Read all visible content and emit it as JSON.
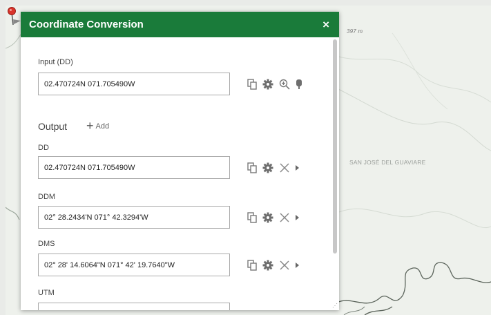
{
  "map": {
    "scale_text": "397 m",
    "place_name": "SAN JOSÉ DEL GUAVIARE"
  },
  "panel": {
    "title": "Coordinate Conversion",
    "close_glyph": "×"
  },
  "input": {
    "label": "Input (DD)",
    "value": "02.470724N 071.705490W",
    "icons": [
      "copy-icon",
      "gear-icon",
      "zoom-in-icon",
      "map-pin-icon"
    ]
  },
  "output": {
    "heading": "Output",
    "add_glyph": "+",
    "add_label": "Add",
    "rows": [
      {
        "label": "DD",
        "value": "02.470724N 071.705490W"
      },
      {
        "label": "DDM",
        "value": "02° 28.2434'N 071° 42.3294'W"
      },
      {
        "label": "DMS",
        "value": "02° 28' 14.6064\"N 071° 42' 19.7640\"W"
      },
      {
        "label": "UTM",
        "value": ""
      }
    ],
    "row_icons": [
      "copy-icon",
      "gear-icon",
      "remove-icon",
      "expand-arrow-icon"
    ]
  },
  "colors": {
    "header": "#1a7b3a",
    "pin_red": "#d9342b"
  }
}
